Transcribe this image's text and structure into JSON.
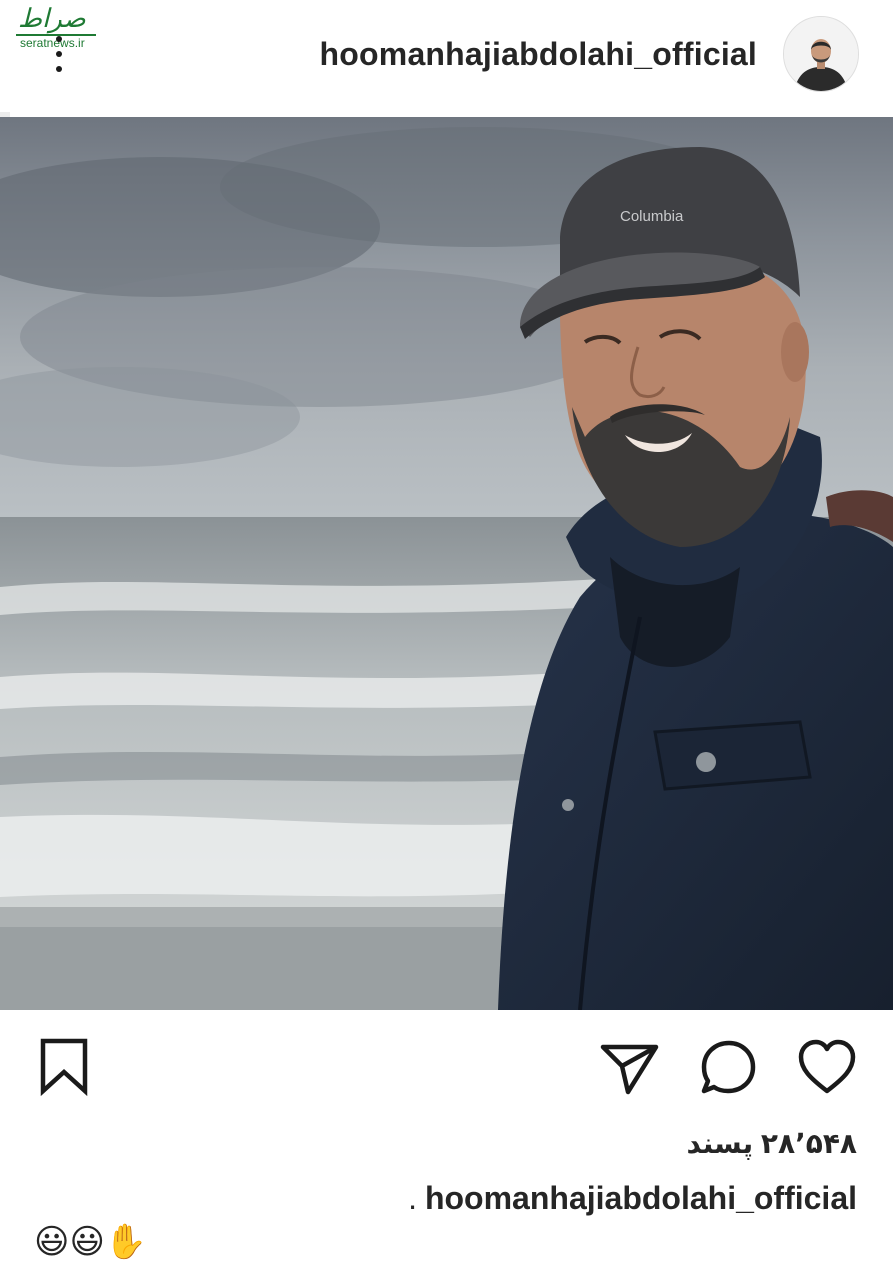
{
  "watermark": {
    "logo_text": "صراط",
    "site_text": "seratnews.ir"
  },
  "post": {
    "username": "hoomanhajiabdolahi_official",
    "photo": {
      "cap_brand": "Columbia"
    },
    "actions": {
      "like_icon": "heart-outline-icon",
      "comment_icon": "speech-bubble-icon",
      "share_icon": "paper-plane-icon",
      "save_icon": "bookmark-icon"
    },
    "likes_text": "۲۸٬۵۴۸ پسند",
    "caption": {
      "username": "hoomanhajiabdolahi_official",
      "trailing": "."
    },
    "comment_emojis": "😃😃✋"
  },
  "colors": {
    "text": "#262626",
    "watermark_green": "#1f7a34",
    "jacket_navy": "#1e2a3d"
  }
}
